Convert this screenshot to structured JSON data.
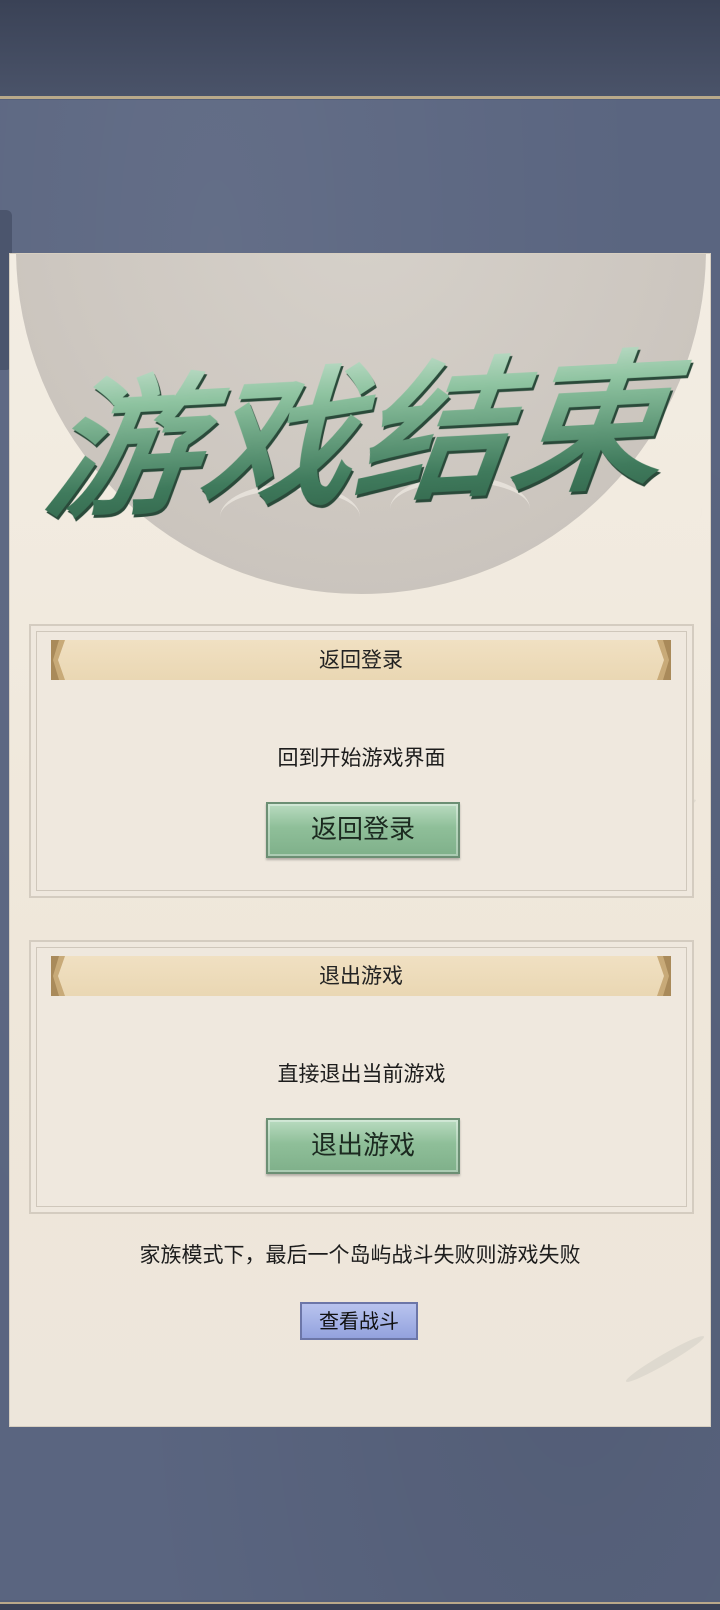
{
  "title": "游戏结束",
  "sections": [
    {
      "header": "返回登录",
      "description": "回到开始游戏界面",
      "button_label": "返回登录"
    },
    {
      "header": "退出游戏",
      "description": "直接退出当前游戏",
      "button_label": "退出游戏"
    }
  ],
  "footer_text": "家族模式下，最后一个岛屿战斗失败则游戏失败",
  "view_battle_label": "查看战斗",
  "colors": {
    "background": "#5a6580",
    "panel": "#f3ede3",
    "title_green": "#4f8a67",
    "button_green": "#8fbf99",
    "view_button_blue": "#93a2de",
    "header_band": "#ead7b3"
  },
  "icons": [
    "chevron-left-icon",
    "chevron-right-icon"
  ]
}
